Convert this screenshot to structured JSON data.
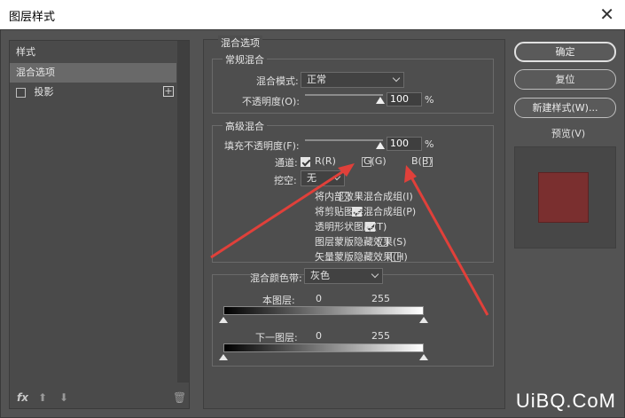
{
  "window": {
    "title": "图层样式",
    "close_icon": "close-icon"
  },
  "left_panel": {
    "header": "样式",
    "items": [
      {
        "label": "混合选项",
        "selected": true,
        "has_checkbox": false
      },
      {
        "label": "投影",
        "selected": false,
        "has_checkbox": true,
        "checked": false
      }
    ],
    "footer_icons": [
      "fx-icon",
      "arrow-up-icon",
      "arrow-down-icon",
      "trash-icon"
    ],
    "fx_label": "fx"
  },
  "blend_options": {
    "section_title": "混合选项",
    "general": {
      "title": "常规混合",
      "mode_label": "混合模式:",
      "mode_value": "正常",
      "opacity_label": "不透明度(O):",
      "opacity_value": "100",
      "opacity_unit": "%",
      "opacity_level": 1.0
    },
    "advanced": {
      "title": "高级混合",
      "fill_label": "填充不透明度(F):",
      "fill_value": "100",
      "fill_unit": "%",
      "fill_level": 1.0,
      "channels_label": "通道:",
      "channels": [
        {
          "label": "R(R)",
          "checked": true
        },
        {
          "label": "G(G)",
          "checked": false
        },
        {
          "label": "B(B)",
          "checked": false
        }
      ],
      "knockout_label": "挖空:",
      "knockout_value": "无",
      "options": [
        {
          "label": "将内部效果混合成组(I)",
          "checked": false
        },
        {
          "label": "将剪贴图层混合成组(P)",
          "checked": true
        },
        {
          "label": "透明形状图层(T)",
          "checked": true
        },
        {
          "label": "图层蒙版隐藏效果(S)",
          "checked": false
        },
        {
          "label": "矢量蒙版隐藏效果(H)",
          "checked": false
        }
      ]
    },
    "blend_if": {
      "label": "混合颜色带:",
      "value": "灰色",
      "this_layer": {
        "label": "本图层:",
        "min": "0",
        "max": "255"
      },
      "underlying": {
        "label": "下一图层:",
        "min": "0",
        "max": "255"
      }
    }
  },
  "buttons": {
    "ok": "确定",
    "reset": "复位",
    "new_style": "新建样式(W)...",
    "preview_label": "预览(V)",
    "preview_checked": true
  },
  "colors": {
    "preview_swatch": "#7a2f2f",
    "annotation_arrow": "#e0403a"
  },
  "watermark": "UiBQ.CoM"
}
